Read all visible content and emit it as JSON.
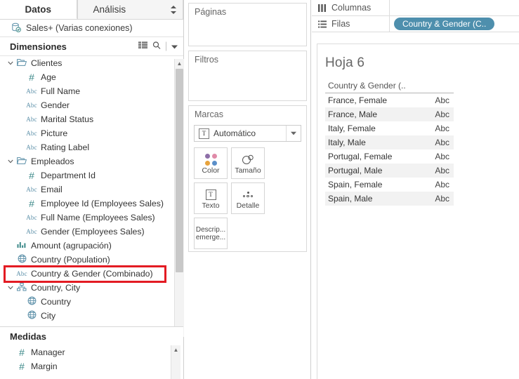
{
  "pane_tabs": {
    "datos": "Datos",
    "analisis": "Análisis"
  },
  "data_source": {
    "name": "Sales+ (Varias conexiones)",
    "icon": "database-icon"
  },
  "dimensions": {
    "header": "Dimensiones",
    "icons": [
      "grid-view-icon",
      "search-icon",
      "chevron-down-icon"
    ],
    "items": [
      {
        "label": "Clientes",
        "icon": "folder-icon",
        "indent": 0,
        "caret": "v"
      },
      {
        "label": "Age",
        "icon": "number-icon",
        "indent": 1,
        "caret": ""
      },
      {
        "label": "Full Name",
        "icon": "abc-icon",
        "indent": 1,
        "caret": ""
      },
      {
        "label": "Gender",
        "icon": "abc-icon",
        "indent": 1,
        "caret": ""
      },
      {
        "label": "Marital Status",
        "icon": "abc-icon",
        "indent": 1,
        "caret": ""
      },
      {
        "label": "Picture",
        "icon": "abc-icon",
        "indent": 1,
        "caret": ""
      },
      {
        "label": "Rating Label",
        "icon": "abc-icon",
        "indent": 1,
        "caret": ""
      },
      {
        "label": "Empleados",
        "icon": "folder-icon",
        "indent": 0,
        "caret": "v"
      },
      {
        "label": "Department Id",
        "icon": "number-icon",
        "indent": 1,
        "caret": ""
      },
      {
        "label": "Email",
        "icon": "abc-icon",
        "indent": 1,
        "caret": ""
      },
      {
        "label": "Employee Id (Employees Sales)",
        "icon": "number-icon",
        "indent": 1,
        "caret": ""
      },
      {
        "label": "Full Name (Employees Sales)",
        "icon": "abc-icon",
        "indent": 1,
        "caret": ""
      },
      {
        "label": "Gender (Employees Sales)",
        "icon": "abc-icon",
        "indent": 1,
        "caret": ""
      },
      {
        "label": "Amount (agrupación)",
        "icon": "bin-icon",
        "indent": 0,
        "caret": ""
      },
      {
        "label": "Country (Population)",
        "icon": "globe-icon",
        "indent": 0,
        "caret": ""
      },
      {
        "label": "Country & Gender (Combinado)",
        "icon": "abc-icon",
        "indent": 0,
        "caret": ""
      },
      {
        "label": "Country, City",
        "icon": "hierarchy-icon",
        "indent": 0,
        "caret": "v"
      },
      {
        "label": "Country",
        "icon": "globe-icon",
        "indent": 1,
        "caret": ""
      },
      {
        "label": "City",
        "icon": "globe-icon",
        "indent": 1,
        "caret": ""
      }
    ]
  },
  "measures": {
    "header": "Medidas",
    "items": [
      {
        "label": "Manager",
        "icon": "number-icon",
        "indent": 0
      },
      {
        "label": "Margin",
        "icon": "number-icon",
        "indent": 0
      }
    ]
  },
  "highlight": {
    "target_label": "Country & Gender (Combinado)",
    "color": "#e31b23"
  },
  "shelf_cards": {
    "paginas": "Páginas",
    "filtros": "Filtros",
    "marcas": "Marcas",
    "mark_type": "Automático",
    "buttons": [
      {
        "label": "Color",
        "icon": "color-dots-icon"
      },
      {
        "label": "Tamaño",
        "icon": "size-circles-icon"
      },
      {
        "label": "Texto",
        "icon": "text-box-icon"
      },
      {
        "label": "Detalle",
        "icon": "detail-dots-icon"
      },
      {
        "label": "Descrip... emerge...",
        "icon": "tooltip-icon"
      }
    ]
  },
  "shelves": {
    "columnas": {
      "label": "Columnas",
      "icon": "columns-icon",
      "pills": []
    },
    "filas": {
      "label": "Filas",
      "icon": "rows-icon",
      "pills": [
        "Country & Gender (C.."
      ]
    }
  },
  "worksheet": {
    "title": "Hoja 6",
    "table": {
      "column_header": "Country & Gender (..",
      "rows": [
        {
          "name": "France, Female",
          "value": "Abc"
        },
        {
          "name": "France, Male",
          "value": "Abc"
        },
        {
          "name": "Italy, Female",
          "value": "Abc"
        },
        {
          "name": "Italy, Male",
          "value": "Abc"
        },
        {
          "name": "Portugal, Female",
          "value": "Abc"
        },
        {
          "name": "Portugal, Male",
          "value": "Abc"
        },
        {
          "name": "Spain, Female",
          "value": "Abc"
        },
        {
          "name": "Spain, Male",
          "value": "Abc"
        }
      ]
    }
  },
  "colors": {
    "pill": "#4e8fad",
    "highlight": "#e31b23",
    "abc_icon": "#5b8fa8",
    "number_icon": "#3e8a8a"
  }
}
